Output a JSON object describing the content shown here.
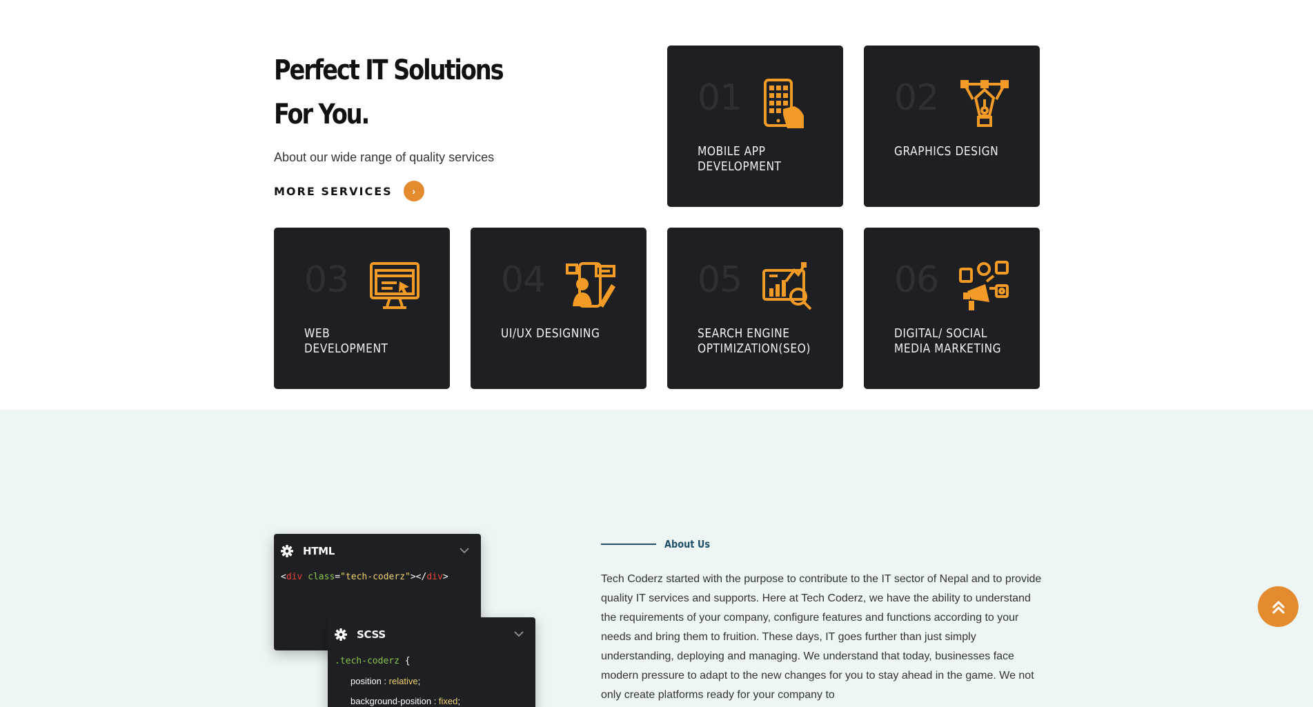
{
  "intro": {
    "title_line1": "Perfect IT Solutions",
    "title_line2": "For You.",
    "subtitle": "About our wide range of quality services",
    "more_label": "MORE SERVICES",
    "more_arrow": "›"
  },
  "services": [
    {
      "num": "01",
      "title": "MOBILE APP DEVELOPMENT",
      "icon": "mobile-app-icon"
    },
    {
      "num": "02",
      "title": "GRAPHICS DESIGN",
      "icon": "pen-tool-icon"
    },
    {
      "num": "03",
      "title": "WEB DEVELOPMENT",
      "icon": "web-monitor-icon"
    },
    {
      "num": "04",
      "title": "UI/UX DESIGNING",
      "icon": "uiux-designer-icon"
    },
    {
      "num": "05",
      "title": "SEARCH ENGINE OPTIMIZATION(SEO)",
      "icon": "seo-analytics-icon"
    },
    {
      "num": "06",
      "title": "DIGITAL/ SOCIAL MEDIA MARKETING",
      "icon": "social-marketing-icon"
    }
  ],
  "code_panels": {
    "html": {
      "name": "HTML",
      "line": {
        "lt": "<",
        "tag": "div",
        "sp": " ",
        "attr": "class",
        "eq": "=",
        "val": "\"tech-coderz\"",
        "mid": "></",
        "tag2": "div",
        "gt": ">"
      }
    },
    "scss": {
      "name": "SCSS",
      "selector": ".tech-coderz",
      "brace": "{",
      "decl1_prop": "position : ",
      "decl1_val": "relative",
      "decl2_prop": "background-position : ",
      "decl2_val": "fixed",
      "semi": ";"
    }
  },
  "about": {
    "tag": "About Us",
    "text": "Tech Coderz started with the purpose to contribute to the IT sector of Nepal and to provide quality IT services and supports. Here at Tech Coderz, we have the ability to understand the requirements of your company, configure features and functions according to your needs and bring them to fruition. These days, IT goes further than just simply understanding, deploying and managing. We understand that today, businesses face modern pressure to adapt to the new changes for you to stay ahead in the game. We not only create platforms ready for your company to"
  },
  "colors": {
    "accent": "#e58b2f",
    "card_bg": "#1e1f23",
    "about_bg": "#edf5f5",
    "heading_blue": "#1f4f66"
  }
}
